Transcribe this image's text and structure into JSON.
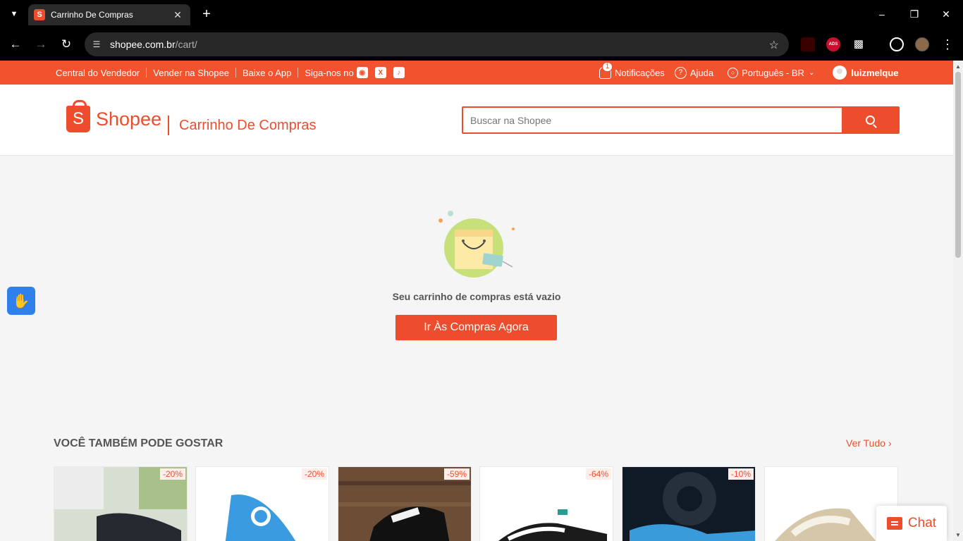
{
  "browser": {
    "tab_title": "Carrinho De Compras",
    "url_host": "shopee.com.br",
    "url_path": "/cart/",
    "ext_ads_label": "ADS"
  },
  "topbar": {
    "left_links": [
      "Central do Vendedor",
      "Vender na Shopee",
      "Baixe o App",
      "Siga-nos no"
    ],
    "notification_count": "1",
    "notifications": "Notificações",
    "help": "Ajuda",
    "language": "Português - BR",
    "username": "luizmelque"
  },
  "header": {
    "logo_text": "Shopee",
    "page_title": "Carrinho De Compras",
    "search_placeholder": "Buscar na Shopee"
  },
  "empty_cart": {
    "message": "Seu carrinho de compras está vazio",
    "button": "Ir Às Compras Agora"
  },
  "recommendations": {
    "title": "VOCÊ TAMBÉM PODE GOSTAR",
    "see_all": "Ver Tudo",
    "products": [
      {
        "discount": "-20%"
      },
      {
        "discount": "-20%"
      },
      {
        "discount": "-59%"
      },
      {
        "discount": "-64%"
      },
      {
        "discount": "-10%"
      },
      {
        "discount": ""
      }
    ]
  },
  "chat": {
    "label": "Chat"
  },
  "colors": {
    "brand": "#ee4d2d",
    "topbar": "#f0532d",
    "background": "#f5f5f5"
  }
}
